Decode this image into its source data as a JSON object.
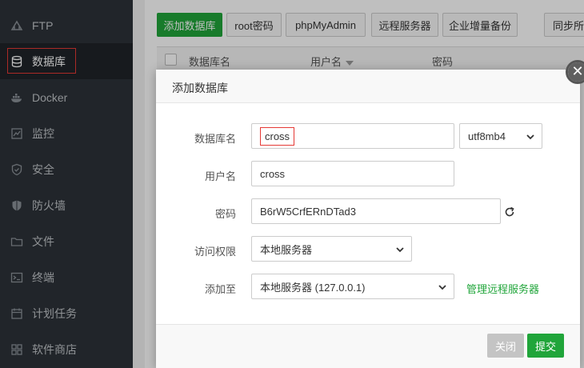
{
  "sidebar": {
    "items": [
      {
        "label": "FTP",
        "icon": "ftp-icon"
      },
      {
        "label": "数据库",
        "icon": "database-icon",
        "active": true
      },
      {
        "label": "Docker",
        "icon": "docker-icon"
      },
      {
        "label": "监控",
        "icon": "monitor-icon"
      },
      {
        "label": "安全",
        "icon": "shield-icon"
      },
      {
        "label": "防火墙",
        "icon": "firewall-icon"
      },
      {
        "label": "文件",
        "icon": "folder-icon"
      },
      {
        "label": "终端",
        "icon": "terminal-icon"
      },
      {
        "label": "计划任务",
        "icon": "calendar-icon"
      },
      {
        "label": "软件商店",
        "icon": "grid-icon"
      }
    ]
  },
  "toolbar": {
    "add_db": "添加数据库",
    "root_pwd": "root密码",
    "phpmyadmin": "phpMyAdmin",
    "remote_server": "远程服务器",
    "enterprise_backup": "企业增量备份",
    "sync_all": "同步所有"
  },
  "table": {
    "headers": [
      "数据库名",
      "用户名",
      "密码"
    ]
  },
  "modal": {
    "title": "添加数据库",
    "db_name_label": "数据库名",
    "db_name_value": "cross",
    "charset_value": "utf8mb4",
    "username_label": "用户名",
    "username_value": "cross",
    "password_label": "密码",
    "password_value": "B6rW5CrfERnDTad3",
    "access_label": "访问权限",
    "access_value": "本地服务器",
    "add_to_label": "添加至",
    "add_to_value": "本地服务器 (127.0.0.1)",
    "manage_remote_link": "管理远程服务器",
    "cancel": "关闭",
    "submit": "提交"
  },
  "colors": {
    "sidebar_bg": "#2d3238",
    "brand_green": "#20a53a",
    "highlight_red": "#e53935"
  }
}
